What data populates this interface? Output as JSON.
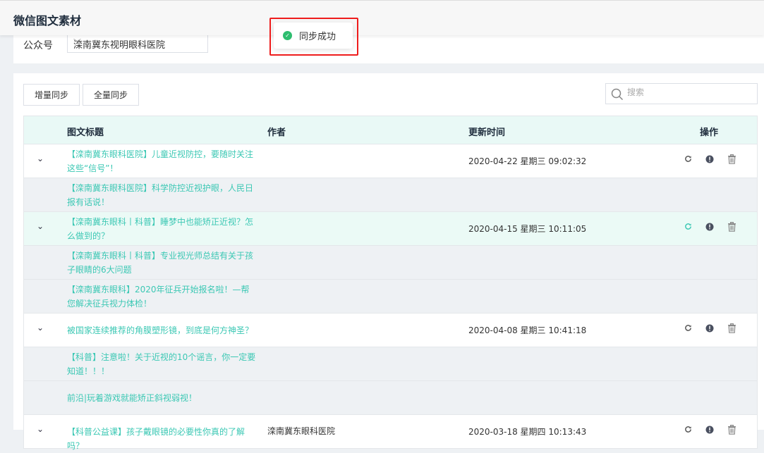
{
  "header": {
    "title": "微信图文素材"
  },
  "account": {
    "label": "公众号",
    "selected": "滦南冀东视明眼科医院"
  },
  "toolbar": {
    "incremental_sync": "增量同步",
    "full_sync": "全量同步",
    "search_placeholder": "搜索"
  },
  "toast": {
    "message": "同步成功"
  },
  "table": {
    "headers": {
      "title": "图文标题",
      "author": "作者",
      "time": "更新时间",
      "actions": "操作"
    },
    "rows": [
      {
        "title": "【滦南冀东眼科医院】儿童近视防控，要随时关注这些“信号”！",
        "author": "",
        "time": "2020-04-22 星期三 09:02:32",
        "parent": true
      },
      {
        "title": "【滦南冀东眼科医院】科学防控近视护眼，人民日报有话说！",
        "author": "",
        "time": "",
        "parent": false
      },
      {
        "title": "【滦南冀东眼科丨科普】睡梦中也能矫正近视？怎么做到的？",
        "author": "",
        "time": "2020-04-15 星期三 10:11:05",
        "parent": true
      },
      {
        "title": "【滦南冀东眼科丨科普】专业视光师总结有关于孩子眼睛的6大问题",
        "author": "",
        "time": "",
        "parent": false
      },
      {
        "title": "【滦南冀东眼科】2020年征兵开始报名啦！—帮您解决征兵视力体检！",
        "author": "",
        "time": "",
        "parent": false
      },
      {
        "title": "被国家连续推荐的角膜塑形镜，到底是何方神圣？",
        "author": "",
        "time": "2020-04-08 星期三 10:41:18",
        "parent": true
      },
      {
        "title": "【科普】注意啦！关于近视的10个谣言，你一定要知道！！！",
        "author": "",
        "time": "",
        "parent": false
      },
      {
        "title": "前沿|玩着游戏就能矫正斜视弱视！",
        "author": "",
        "time": "",
        "parent": false
      },
      {
        "title": "【科普公益课】孩子戴眼镜的必要性你真的了解吗？",
        "author": "滦南冀东眼科医院",
        "time": "2020-03-18 星期四 10:13:43",
        "parent": true
      }
    ]
  },
  "colors": {
    "accent": "#3cc8b4",
    "success": "#2ebd6f",
    "highlight": "#ee1c1c"
  }
}
